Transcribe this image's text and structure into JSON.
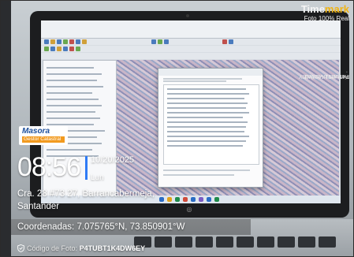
{
  "watermark": {
    "brand_prefix": "Time",
    "brand_suffix": "mark",
    "tagline": "Foto 100% Real",
    "vertical_code_label": "P4TUBT1K4DW6EY",
    "vertical_code_brand": "Timemark Verified",
    "company": {
      "name": "Masora",
      "subtitle": "Gestor Catastral"
    },
    "time": "08:56",
    "date": "10/20/2025",
    "weekday": "Lun",
    "address_line1": "Cra. 28 #73 27, Barrancabermeja,",
    "address_line2": "Santander",
    "coordinates": "Coordenadas: 7.075765°N, 73.850901°W",
    "photo_code_label": "Código de Foto:",
    "photo_code_value": "P4TUBT1K4DW6EY",
    "accent_color": "#2f7bf5",
    "icons": [
      "shield-check-icon"
    ]
  }
}
